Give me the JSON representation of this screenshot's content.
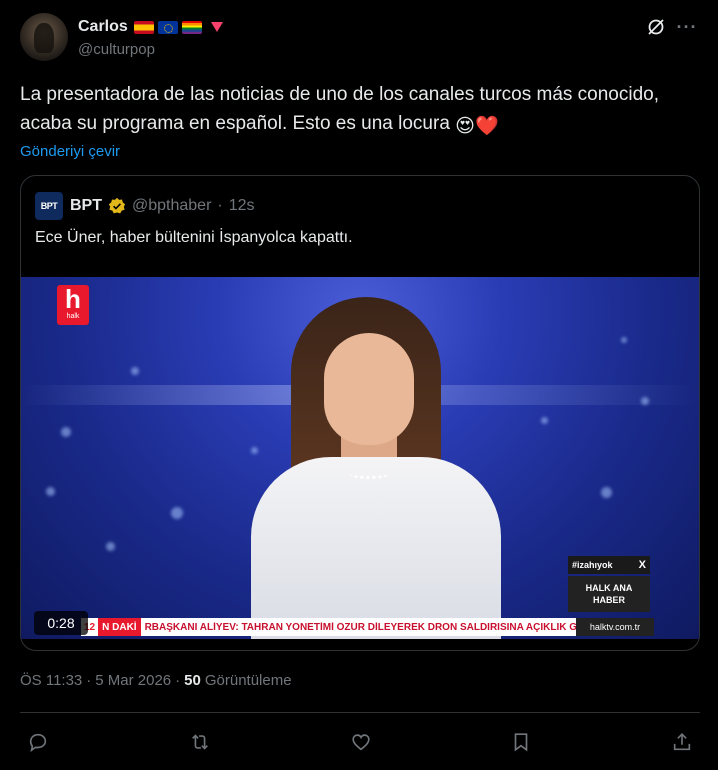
{
  "author": {
    "name": "Carlos",
    "handle": "@culturpop",
    "badges": [
      "spain-flag",
      "eu-flag",
      "rainbow-flag",
      "red-triangle"
    ]
  },
  "post": {
    "text": "La presentadora de las noticias de uno de los canales turcos más conocido, acaba su programa en español. Esto es una locura",
    "emojis": [
      "😍",
      "❤️"
    ],
    "translate_label": "Gönderiyi çevir"
  },
  "quote": {
    "avatar_text": "BPT",
    "name": "BPT",
    "handle": "@bpthaber",
    "dot": "·",
    "time": "12s",
    "text": "Ece Üner, haber bültenini İspanyolca kapattı.",
    "video": {
      "duration": "0:28",
      "channel_logo": "h",
      "channel_sub": "halk",
      "hashtag": "#izahıyok",
      "hashtag_x": "X",
      "show_line1": "HALK ANA",
      "show_line2": "HABER",
      "ticker_num": "12",
      "ticker_label": "N DAKİ",
      "ticker_text": "RBAŞKANI ALİYEV: TAHRAN YÖNETİMİ ÖZÜR DİLEYEREK DRON SALDIRISINA AÇIKLIK GE",
      "ticker_url": "halktv.com.tr"
    }
  },
  "meta": {
    "time": "ÖS 11:33",
    "sep1": "·",
    "date": "5 Mar 2026",
    "sep2": "·",
    "views_count": "50",
    "views_label": "Görüntüleme"
  },
  "actions": [
    "reply-icon",
    "repost-icon",
    "like-icon",
    "bookmark-icon",
    "share-icon"
  ],
  "colors": {
    "background": "#000000",
    "text": "#e7e9ea",
    "muted": "#71767b",
    "link": "#1d9bf0",
    "border": "#2f3336",
    "verified_gold": "#e2b719",
    "halk_red": "#e8192c"
  }
}
